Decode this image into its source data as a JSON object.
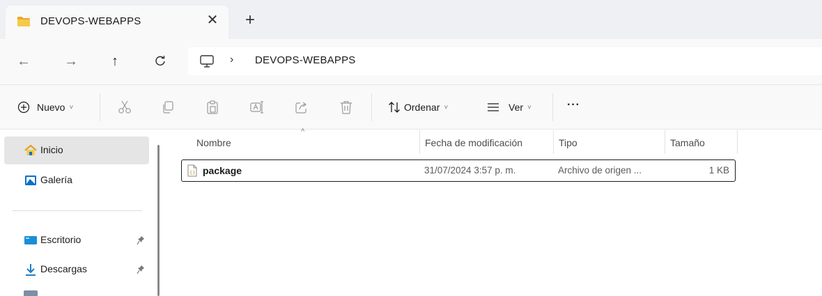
{
  "tab": {
    "title": "DEVOPS-WEBAPPS",
    "close_glyph": "✕",
    "new_tab_glyph": "+"
  },
  "navigation": {
    "back_glyph": "←",
    "forward_glyph": "→",
    "up_glyph": "↑",
    "refresh_glyph": "C"
  },
  "address": {
    "separator": "›",
    "path": "DEVOPS-WEBAPPS"
  },
  "commands": {
    "new_label": "Nuevo",
    "sort_label": "Ordenar",
    "view_label": "Ver",
    "more_label": "···",
    "caret": "˅"
  },
  "sidebar": {
    "items": [
      {
        "label": "Inicio",
        "icon": "home-icon",
        "selected": true
      },
      {
        "label": "Galería",
        "icon": "gallery-icon"
      },
      {
        "label": "Escritorio",
        "icon": "desktop-icon",
        "pinned": true
      },
      {
        "label": "Descargas",
        "icon": "downloads-icon",
        "pinned": true
      }
    ]
  },
  "columns": {
    "name": "Nombre",
    "modified": "Fecha de modificación",
    "type": "Tipo",
    "size": "Tamaño"
  },
  "files": [
    {
      "name": "package",
      "modified": "31/07/2024 3:57 p. m.",
      "type": "Archivo de origen ...",
      "size": "1 KB"
    }
  ],
  "colors": {
    "folder": "#f4c24e",
    "accent": "#0067c0",
    "selected_bg": "#e5e5e5"
  }
}
